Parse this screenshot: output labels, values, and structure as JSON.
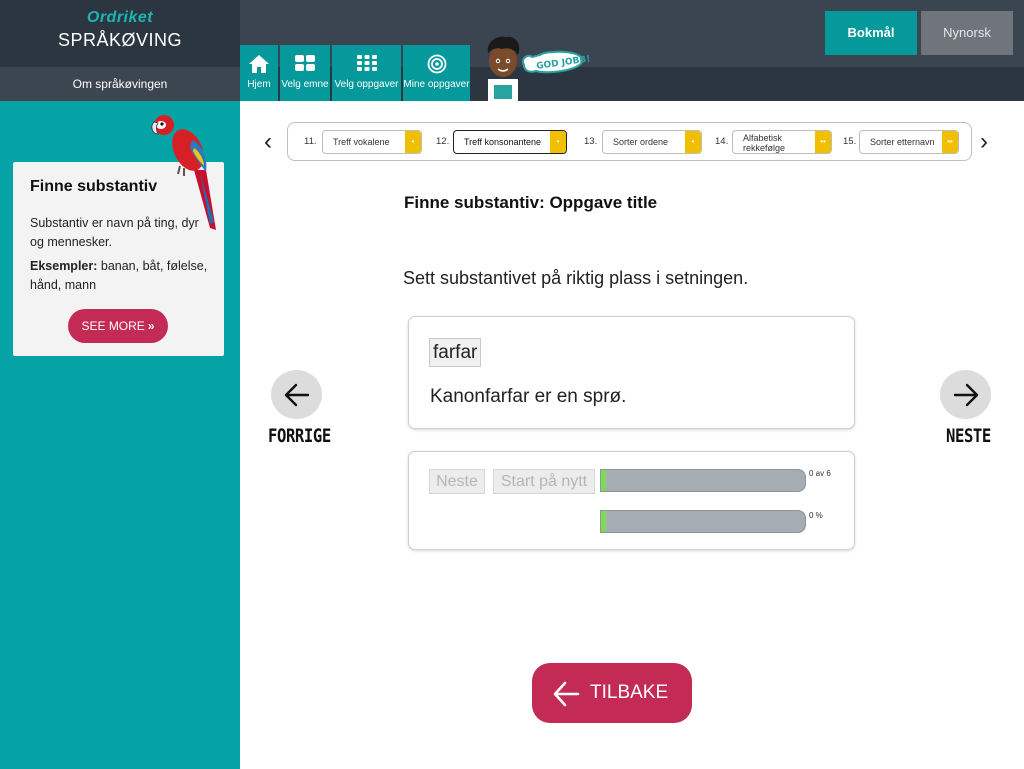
{
  "brand": {
    "logo": "Ordriket",
    "title": "SPRÅKØVING"
  },
  "sidebar": {
    "about_link": "Om språkøvingen",
    "card": {
      "heading": "Finne substantiv",
      "description": "Substantiv er navn på ting, dyr og mennesker.",
      "examples_label": "Eksempler:",
      "examples_text": " banan, båt, følelse, hånd, mann",
      "see_more": "SEE MORE",
      "see_more_icon": "double-chevron-right"
    }
  },
  "header": {
    "languages": [
      "Bokmål",
      "Nynorsk"
    ],
    "active_language": "Bokmål",
    "nav": [
      {
        "label": "Hjem",
        "icon": "home-icon"
      },
      {
        "label": "Velg emne",
        "icon": "grid-4-icon"
      },
      {
        "label": "Velg oppgaver",
        "icon": "grid-9-icon"
      },
      {
        "label": "Mine oppgaver",
        "icon": "target-icon"
      }
    ],
    "mascot_bubble": "GOD JOBB!"
  },
  "task_strip": {
    "tasks": [
      {
        "num": "11.",
        "label": "Treff vokalene",
        "tag": "•"
      },
      {
        "num": "12.",
        "label": "Treff konsonantene",
        "tag": "•",
        "active": true
      },
      {
        "num": "13.",
        "label": "Sorter ordene",
        "tag": "•"
      },
      {
        "num": "14.",
        "label_line1": "Alfabetisk",
        "label_line2": "rekkefølge",
        "tag": "••"
      },
      {
        "num": "15.",
        "label": "Sorter etternavn",
        "tag": "••"
      }
    ]
  },
  "main": {
    "title": "Finne substantiv: Oppgave title",
    "instruction": "Sett substantivet på riktig plass i setningen.",
    "word_chip": "farfar",
    "sentence": "Kanonfarfar er en sprø.",
    "controls": {
      "next_label": "Neste",
      "restart_label": "Start på nytt",
      "progress_label": "0 av 6",
      "progress_value": 0,
      "score_label": "0 %",
      "score_value": 0
    }
  },
  "navigation": {
    "prev_label": "FORRIGE",
    "next_label": "NESTE",
    "back_label": "TILBAKE"
  },
  "colors": {
    "teal": "#06a3a6",
    "dark_header": "#2c3640",
    "accent_red": "#c32b55",
    "tag_yellow": "#f0c000"
  }
}
